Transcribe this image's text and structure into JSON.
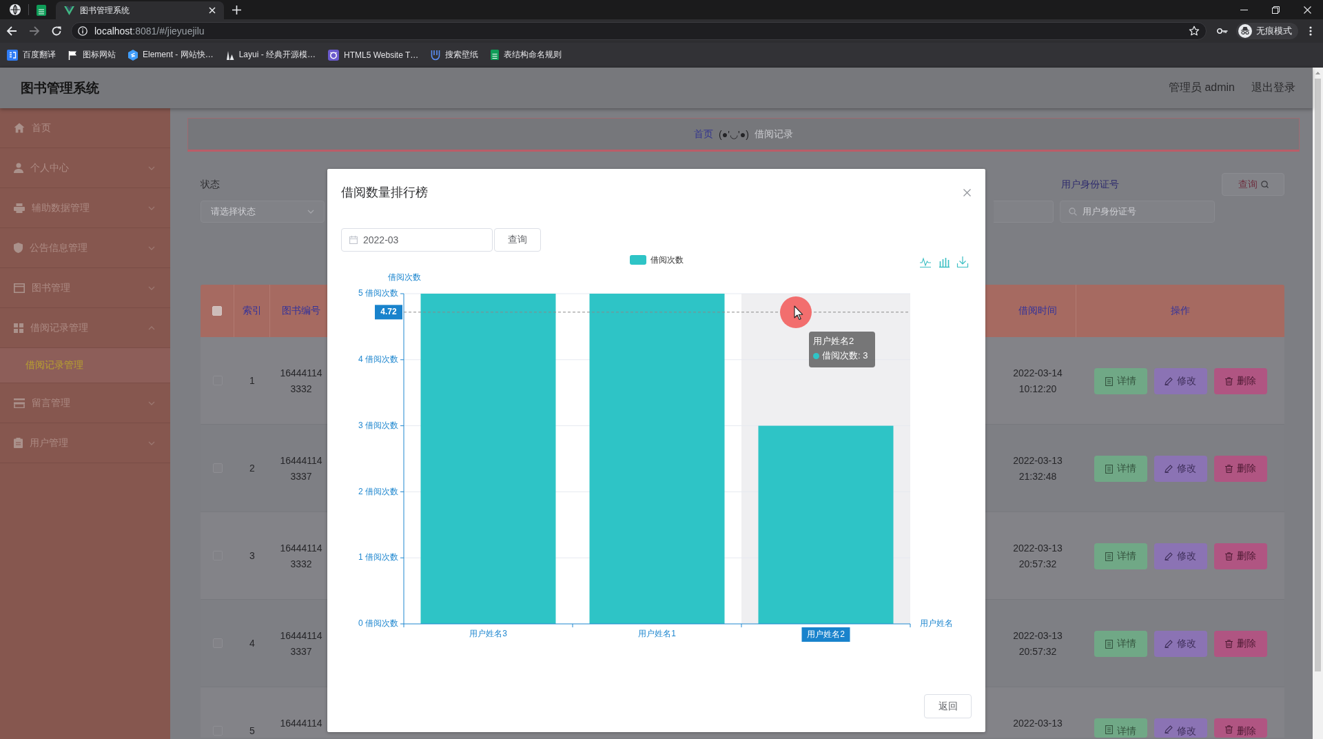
{
  "browser": {
    "tabs": [
      {
        "kind": "pinned",
        "selected": false
      },
      {
        "kind": "page",
        "title": "图书管理系统",
        "selected": true
      }
    ],
    "nav": [
      {
        "kind": "back",
        "disabled": false
      },
      {
        "kind": "forward",
        "disabled": true
      },
      {
        "kind": "reload",
        "disabled": false
      }
    ],
    "address": {
      "host": "localhost",
      "rest": ":8081/#/jieyuejilu"
    },
    "profile": "无痕模式",
    "bookmarks": [
      "百度翻译",
      "图标网站",
      "Element - 网站快…",
      "Layui - 经典开源模…",
      "HTML5 Website T…",
      "搜索壁纸",
      "表结构命名规则"
    ]
  },
  "header": {
    "title": "图书管理系统",
    "user": "管理员 admin",
    "logout": "退出登录"
  },
  "sidebar": {
    "items": [
      {
        "label": "首页",
        "kind": "link",
        "selected": false
      },
      {
        "label": "个人中心",
        "kind": "menu",
        "expanded": false,
        "selected": false
      },
      {
        "label": "辅助数据管理",
        "kind": "menu",
        "expanded": false,
        "selected": false
      },
      {
        "label": "公告信息管理",
        "kind": "menu",
        "expanded": false,
        "selected": false
      },
      {
        "label": "图书管理",
        "kind": "menu",
        "expanded": false,
        "selected": false
      },
      {
        "label": "借阅记录管理",
        "kind": "menu",
        "expanded": true,
        "selected": false,
        "children": [
          {
            "label": "借阅记录管理",
            "selected": true
          }
        ]
      },
      {
        "label": "留言管理",
        "kind": "menu",
        "expanded": false,
        "selected": false
      },
      {
        "label": "用户管理",
        "kind": "menu",
        "expanded": false,
        "selected": false
      }
    ]
  },
  "breadcrumb": [
    {
      "kind": "link",
      "label": "首页"
    },
    {
      "kind": "separator",
      "label": "(●'◡'●)"
    },
    {
      "kind": "current",
      "label": "借阅记录"
    }
  ],
  "filters": [
    {
      "kind": "select",
      "label": "状态",
      "placeholder": "请选择状态"
    },
    {
      "kind": "input"
    },
    {
      "kind": "search",
      "label": "用户身份证号",
      "placeholder": "用户身份证号"
    }
  ],
  "search_button": "查询",
  "table": {
    "checked": false,
    "columns": [
      "索引",
      "图书编号",
      "借阅时间",
      "操作"
    ],
    "rows": [
      {
        "checked": false,
        "index": "1",
        "book_no": "164441143332",
        "borrow_time": "2022-03-14 10:12:20",
        "actions": [
          {
            "kind": "detail",
            "label": "详情"
          },
          {
            "kind": "edit",
            "label": "修改"
          },
          {
            "kind": "delete",
            "label": "删除"
          }
        ]
      },
      {
        "checked": false,
        "index": "2",
        "book_no": "164441143337",
        "borrow_time": "2022-03-13 21:32:48",
        "actions": [
          {
            "kind": "detail",
            "label": "详情"
          },
          {
            "kind": "edit",
            "label": "修改"
          },
          {
            "kind": "delete",
            "label": "删除"
          }
        ]
      },
      {
        "checked": false,
        "index": "3",
        "book_no": "164441143332",
        "borrow_time": "2022-03-13 20:57:32",
        "actions": [
          {
            "kind": "detail",
            "label": "详情"
          },
          {
            "kind": "edit",
            "label": "修改"
          },
          {
            "kind": "delete",
            "label": "删除"
          }
        ]
      },
      {
        "checked": false,
        "index": "4",
        "book_no": "164441143337",
        "borrow_time": "2022-03-13 20:57:32",
        "actions": [
          {
            "kind": "detail",
            "label": "详情"
          },
          {
            "kind": "edit",
            "label": "修改"
          },
          {
            "kind": "delete",
            "label": "删除"
          }
        ]
      },
      {
        "checked": false,
        "index": "5",
        "book_no": "16444114",
        "borrow_time": "2022-03-13",
        "actions": [
          {
            "kind": "detail",
            "label": "详情"
          },
          {
            "kind": "edit",
            "label": "修改"
          },
          {
            "kind": "delete",
            "label": "删除"
          }
        ]
      }
    ]
  },
  "dialog": {
    "title": "借阅数量排行榜",
    "month": {
      "value": "2022-03"
    },
    "query": "查询",
    "chart": {
      "chart_data": {
        "type": "bar",
        "xlabel": "用户姓名",
        "ylabel": "借阅次数",
        "categories": [
          "用户姓名3",
          "用户姓名1",
          "用户姓名2"
        ],
        "series": [
          {
            "name": "借阅次数",
            "color": "#2ec4c6",
            "values": [
              5,
              5,
              3
            ]
          }
        ],
        "ylim": [
          0,
          5
        ],
        "yticks": [
          {
            "value": 0,
            "label": "0 借阅次数"
          },
          {
            "value": 1,
            "label": "1 借阅次数"
          },
          {
            "value": 2,
            "label": "2 借阅次数"
          },
          {
            "value": 3,
            "label": "3 借阅次数"
          },
          {
            "value": 4,
            "label": "4 借阅次数"
          },
          {
            "value": 5,
            "label": "5 借阅次数"
          }
        ],
        "grid": true,
        "ref_lines": [
          {
            "axis": "y",
            "value": 4.72,
            "label": "4.72"
          }
        ],
        "bands": [
          {
            "axis": "x",
            "from": "用户姓名2",
            "to": "用户姓名2"
          }
        ]
      },
      "tooltip": {
        "title": "用户姓名2",
        "text": "借阅次数: 3"
      }
    },
    "back": "返回"
  }
}
